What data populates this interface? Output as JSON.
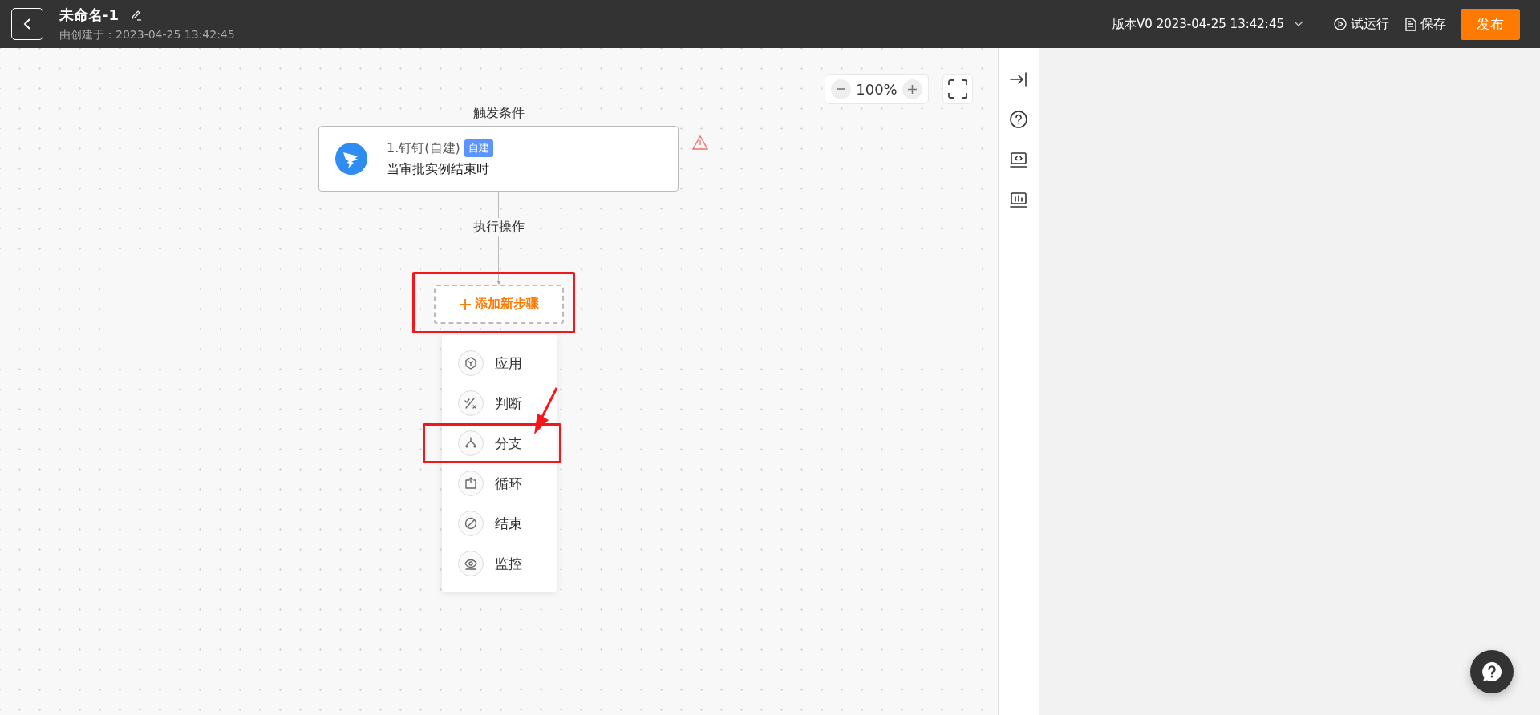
{
  "header": {
    "title": "未命名-1",
    "subtitle": "由创建于：2023-04-25 13:42:45",
    "version": "版本V0 2023-04-25 13:42:45",
    "actions": [
      {
        "kind": "run",
        "label": "试运行"
      },
      {
        "kind": "save",
        "label": "保存"
      }
    ],
    "publish": "发布"
  },
  "zoom": {
    "value": "100%"
  },
  "flow": {
    "trigger_label": "触发条件",
    "trigger_node": {
      "title": "1.钉钉(自建)",
      "tag": "自建",
      "description": "当审批实例结束时",
      "warning": true
    },
    "action_label": "执行操作",
    "add_step": {
      "label": "添加新步骤",
      "highlighted": true
    }
  },
  "step_menu": {
    "items": [
      {
        "kind": "app",
        "label": "应用",
        "highlighted": false
      },
      {
        "kind": "judge",
        "label": "判断",
        "highlighted": false
      },
      {
        "kind": "branch",
        "label": "分支",
        "highlighted": true
      },
      {
        "kind": "loop",
        "label": "循环",
        "highlighted": false
      },
      {
        "kind": "end",
        "label": "结束",
        "highlighted": false
      },
      {
        "kind": "monitor",
        "label": "监控",
        "highlighted": false
      }
    ]
  }
}
